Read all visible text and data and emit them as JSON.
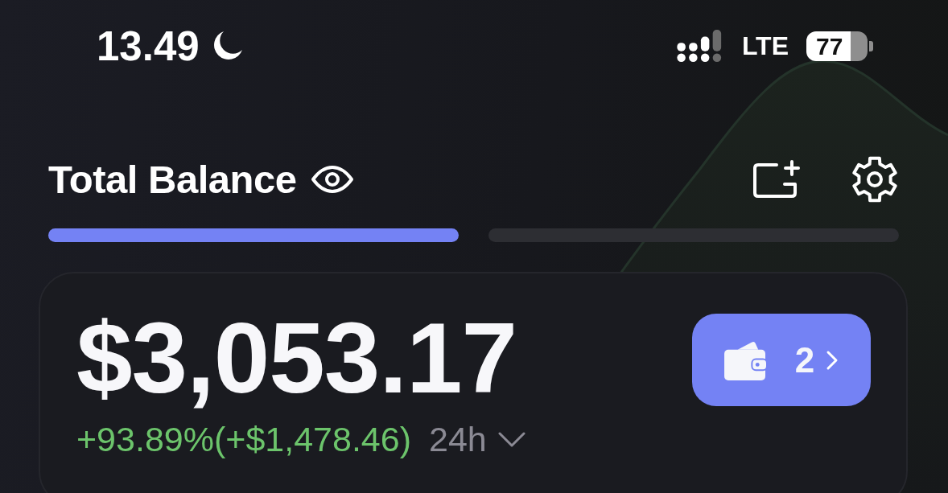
{
  "status_bar": {
    "time": "13.49",
    "network": "LTE",
    "battery": "77"
  },
  "header": {
    "title": "Total Balance"
  },
  "pages": [
    {
      "selected": true
    },
    {
      "selected": false
    }
  ],
  "balance": {
    "amount": "$3,053.17",
    "wallet_count": "2",
    "change": "+93.89%(+$1,478.46)",
    "period": "24h"
  }
}
